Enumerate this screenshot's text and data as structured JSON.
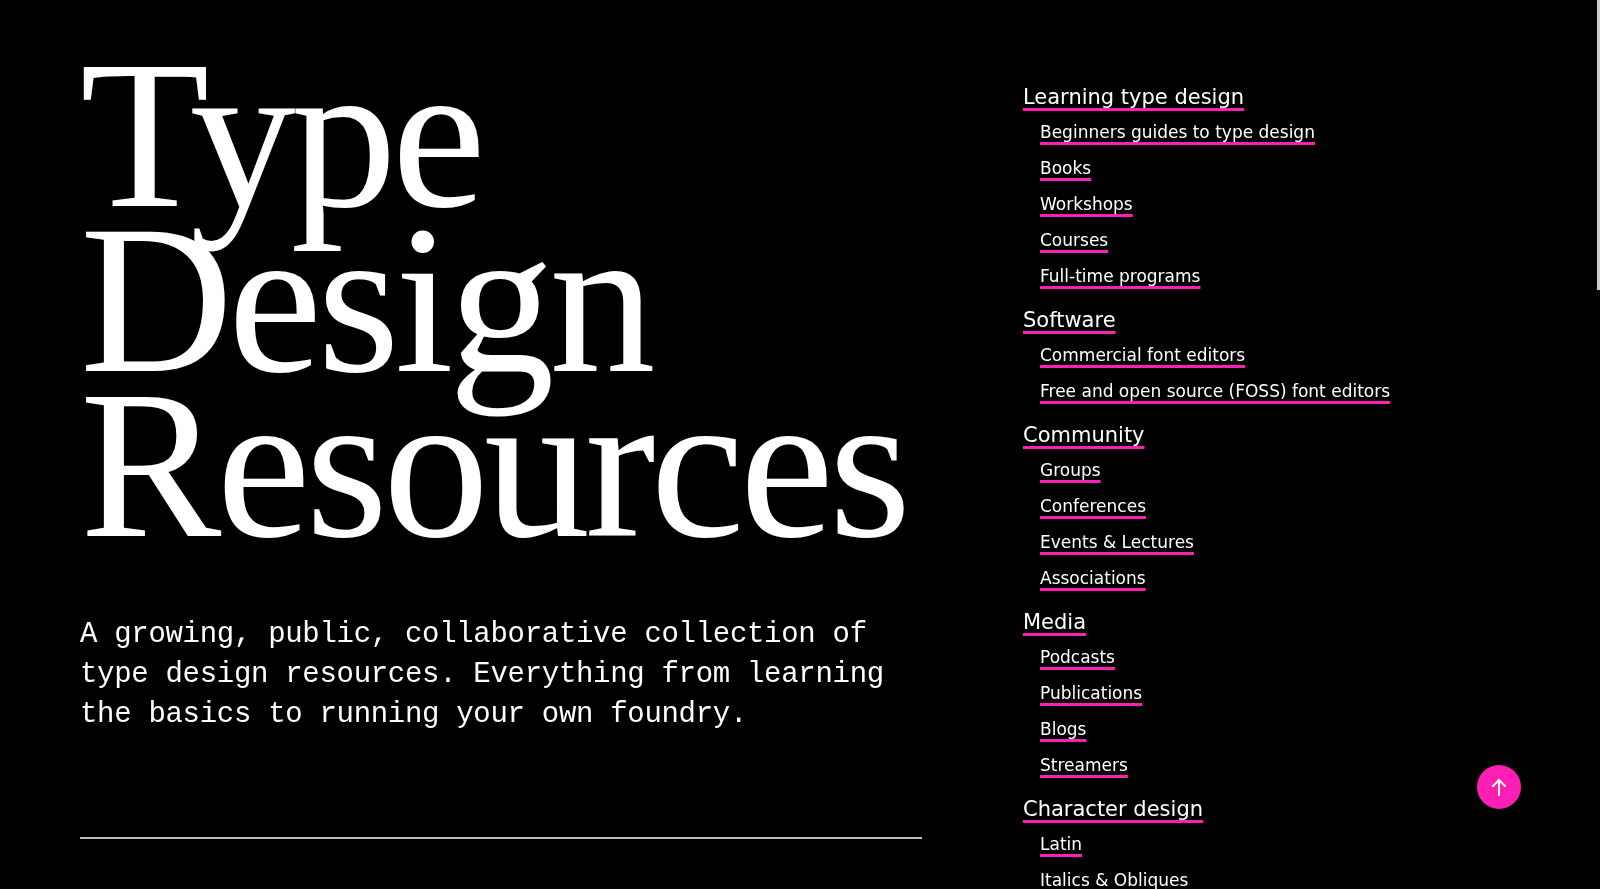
{
  "title": [
    "Type",
    "Design",
    "Resources"
  ],
  "intro": "A growing, public, collaborative collection of type design resources. Everything from learning the basics to running your own foundry.",
  "nav": [
    {
      "label": "Learning type design",
      "children": [
        {
          "label": "Beginners guides to type design"
        },
        {
          "label": "Books"
        },
        {
          "label": "Workshops"
        },
        {
          "label": "Courses"
        },
        {
          "label": "Full-time programs"
        }
      ]
    },
    {
      "label": "Software",
      "children": [
        {
          "label": "Commercial font editors"
        },
        {
          "label": "Free and open source (FOSS) font editors"
        }
      ]
    },
    {
      "label": "Community",
      "children": [
        {
          "label": "Groups"
        },
        {
          "label": "Conferences"
        },
        {
          "label": "Events & Lectures"
        },
        {
          "label": "Associations"
        }
      ]
    },
    {
      "label": "Media",
      "children": [
        {
          "label": "Podcasts"
        },
        {
          "label": "Publications"
        },
        {
          "label": "Blogs"
        },
        {
          "label": "Streamers"
        }
      ]
    },
    {
      "label": "Character design",
      "children": [
        {
          "label": "Latin"
        },
        {
          "label": "Italics & Obliques"
        }
      ]
    }
  ]
}
